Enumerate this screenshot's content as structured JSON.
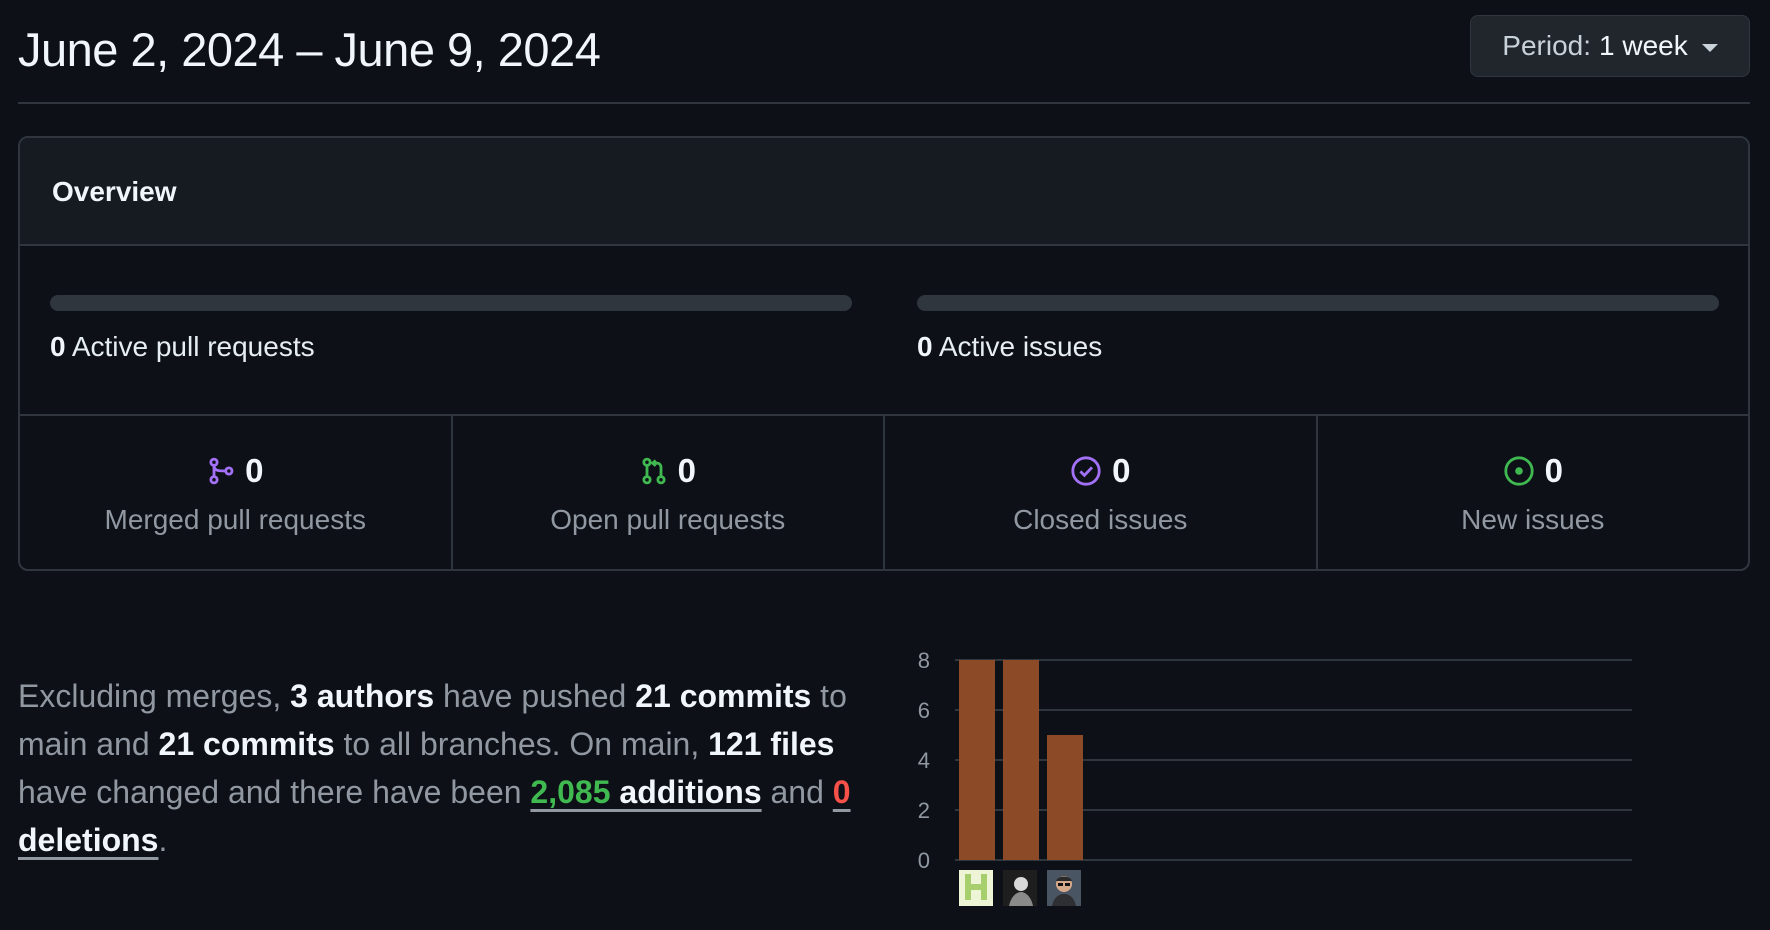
{
  "header": {
    "date_range": "June 2, 2024 – June 9, 2024",
    "period_prefix": "Period:",
    "period_value": "1 week"
  },
  "overview": {
    "title": "Overview",
    "active_pull_requests": {
      "count": "0",
      "label": "Active pull requests",
      "progress": 0
    },
    "active_issues": {
      "count": "0",
      "label": "Active issues",
      "progress": 0
    },
    "stats": [
      {
        "count": "0",
        "label": "Merged pull requests",
        "icon": "git-merge-icon",
        "color": "#a371f7"
      },
      {
        "count": "0",
        "label": "Open pull requests",
        "icon": "git-pull-request-icon",
        "color": "#3fb950"
      },
      {
        "count": "0",
        "label": "Closed issues",
        "icon": "issue-closed-icon",
        "color": "#a371f7"
      },
      {
        "count": "0",
        "label": "New issues",
        "icon": "issue-opened-icon",
        "color": "#3fb950"
      }
    ]
  },
  "summary": {
    "t1": "Excluding merges, ",
    "authors": "3 authors",
    "t2": " have pushed ",
    "commits_main": "21 commits",
    "t3": " to main and ",
    "commits_all": "21 commits",
    "t4": " to all branches. On main, ",
    "files": "121 files",
    "t5": " have changed and there have been ",
    "additions_count": "2,085",
    "additions_label": " additions",
    "t6": " and ",
    "deletions_count": "0",
    "deletions_label": " deletions",
    "t7": "."
  },
  "colors": {
    "bar": "#8c4a27",
    "grid": "#30363d",
    "additions": "#3fb950",
    "deletions": "#f85149"
  },
  "chart_data": {
    "type": "bar",
    "categories": [
      "author-1",
      "author-2",
      "author-3"
    ],
    "values": [
      8,
      8,
      5
    ],
    "ylim": [
      0,
      8
    ],
    "yticks": [
      "0",
      "2",
      "4",
      "6",
      "8"
    ],
    "grid": true,
    "x_tick_labels": "avatars"
  }
}
